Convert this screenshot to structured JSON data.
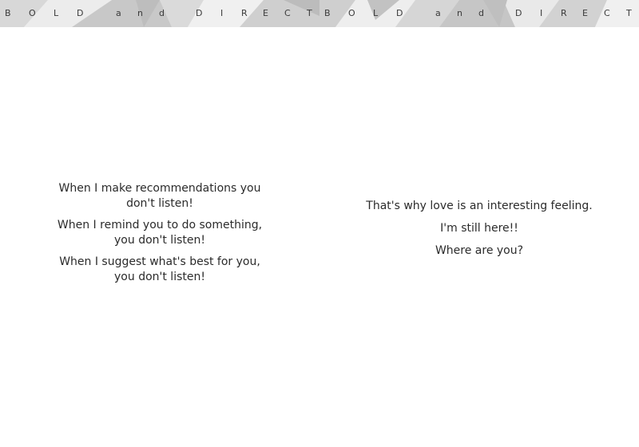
{
  "pages": [
    {
      "header": {
        "letters": [
          "B",
          "O",
          "L",
          "D",
          "a",
          "n",
          "d",
          "D",
          "I",
          "R",
          "E",
          "C",
          "T"
        ]
      },
      "paragraphs": [
        "When I make recommendations you don't listen!",
        "When I remind you to do something, you don't listen!",
        "When I suggest what's best for you, you don't listen!"
      ]
    },
    {
      "header": {
        "letters": [
          "B",
          "O",
          "L",
          "D",
          "a",
          "n",
          "d",
          "D",
          "I",
          "R",
          "E",
          "C",
          "T"
        ]
      },
      "paragraphs": [
        "That's why love is an interesting feeling.",
        "I'm still here!!",
        "Where are you?"
      ]
    }
  ],
  "colors": {
    "band_base": "#e6e6e6",
    "band_shade_dark": "#c4c4c4",
    "band_shade_mid": "#d2d2d2",
    "band_shade_light": "#f0f0f0",
    "text": "#2b2b2b"
  }
}
